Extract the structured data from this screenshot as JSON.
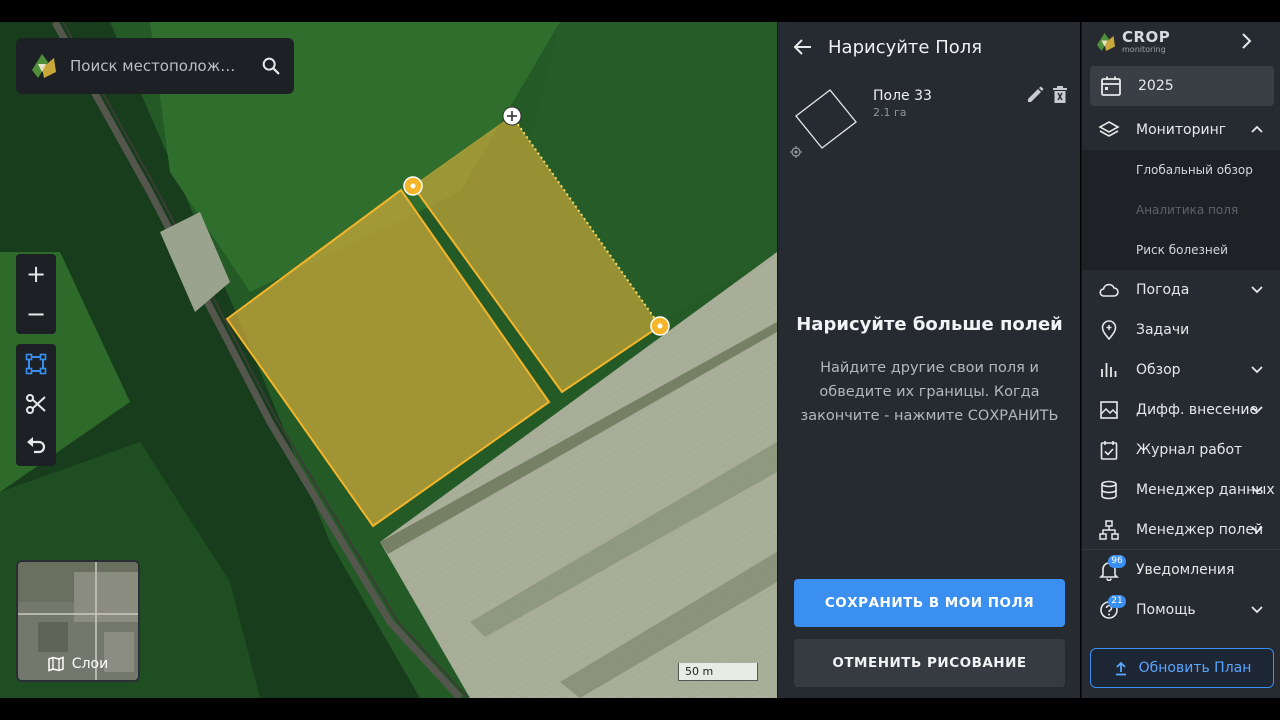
{
  "search": {
    "placeholder": "Поиск местополож…"
  },
  "map": {
    "zoom_in": "+",
    "zoom_out": "−",
    "layers_label": "Слои",
    "scale_label": "50 m"
  },
  "draw_panel": {
    "title": "Нарисуйте Поля",
    "field": {
      "name": "Поле 33",
      "area": "2.1 га"
    },
    "more_title": "Нарисуйте больше полей",
    "more_desc": "Найдите другие свои поля и обведите их границы. Когда закончите - нажмите СОХРАНИТЬ",
    "save_button": "СОХРАНИТЬ В МОИ ПОЛЯ",
    "cancel_button": "ОТМЕНИТЬ РИСОВАНИЕ"
  },
  "sidebar": {
    "brand": {
      "name": "CROP",
      "sub": "monitoring"
    },
    "year": "2025",
    "items": [
      {
        "label": "Мониторинг",
        "icon": "layers-icon",
        "expanded": true
      },
      {
        "label": "Погода",
        "icon": "cloud-icon"
      },
      {
        "label": "Задачи",
        "icon": "pin-icon"
      },
      {
        "label": "Обзор",
        "icon": "bar-chart-icon"
      },
      {
        "label": "Дифф. внесение",
        "icon": "image-icon"
      },
      {
        "label": "Журнал работ",
        "icon": "checklist-icon"
      },
      {
        "label": "Менеджер данных",
        "icon": "database-icon"
      },
      {
        "label": "Менеджер полей",
        "icon": "hierarchy-icon"
      },
      {
        "label": "Уведомления",
        "icon": "bell-icon",
        "badge": "96"
      },
      {
        "label": "Помощь",
        "icon": "help-icon",
        "badge": "21"
      }
    ],
    "monitoring_sub": [
      {
        "label": "Глобальный обзор",
        "enabled": true
      },
      {
        "label": "Аналитика поля",
        "enabled": false
      },
      {
        "label": "Риск болезней",
        "enabled": true
      }
    ],
    "upgrade_button": "Обновить План"
  },
  "colors": {
    "accent": "#3b8ff0",
    "field_fill": "#c9a83a",
    "field_stroke": "#f5b52a",
    "panel_bg": "#262b31"
  }
}
